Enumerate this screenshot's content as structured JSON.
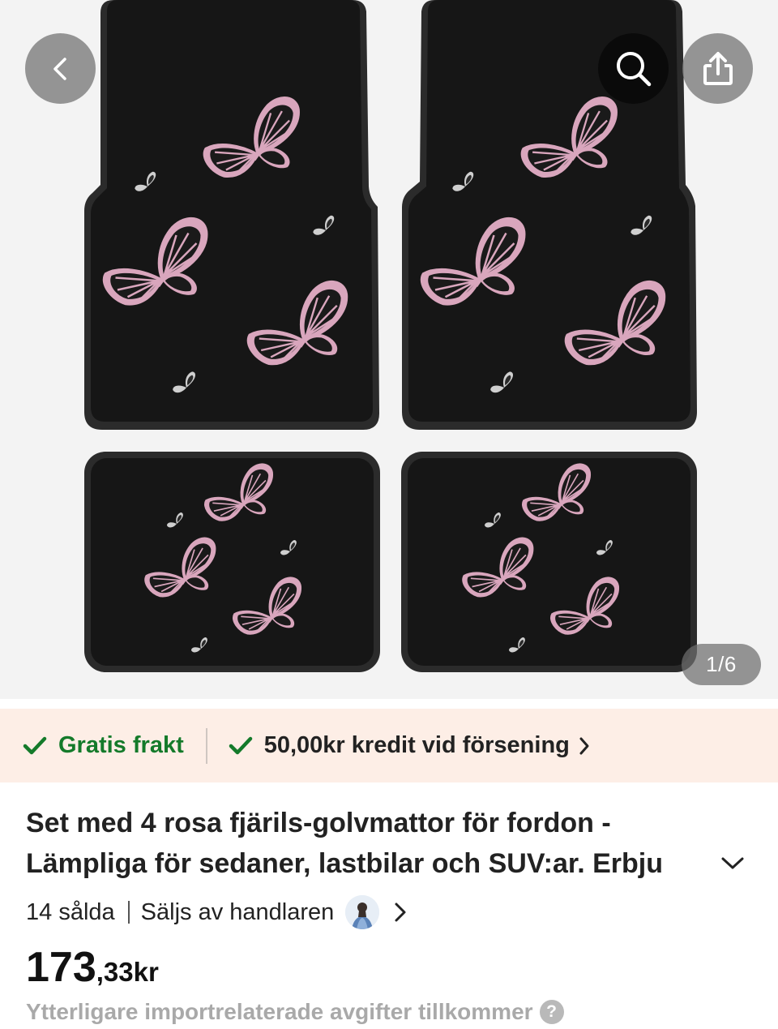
{
  "gallery": {
    "counter": "1/6"
  },
  "shipping": {
    "free_shipping": "Gratis frakt",
    "credit": "50,00kr kredit vid försening"
  },
  "product": {
    "title_line1": "Set med 4 rosa fjärils-golvmattor för fordon -",
    "title_line2": "Lämpliga för sedaner, lastbilar och SUV:ar. Erbju",
    "sold": "14 sålda",
    "seller": "Säljs av handlaren",
    "price_int": "173",
    "price_dec": ",33kr",
    "fees_note": "Ytterligare importrelaterade avgifter tillkommer"
  },
  "icons": {
    "back": "chevron-left-icon",
    "search": "search-icon",
    "share": "share-icon",
    "check": "check-icon",
    "chevron_right": "chevron-right-icon",
    "chevron_down": "chevron-down-icon",
    "help": "question-icon"
  },
  "colors": {
    "banner_bg": "#fdeee6",
    "free_shipping_green": "#147a2a",
    "mat_black": "#161616",
    "butterfly_pink": "#d9a6bd"
  }
}
